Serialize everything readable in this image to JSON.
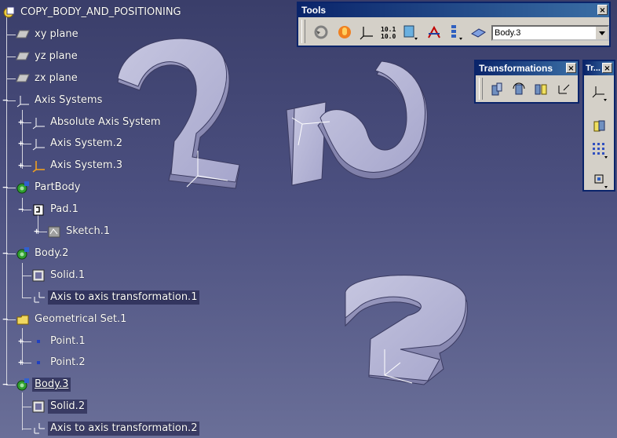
{
  "tree": {
    "nodes": [
      {
        "label": "COPY_BODY_AND_POSITIONING",
        "icon": "part-root-icon"
      },
      {
        "label": "xy plane",
        "icon": "plane-icon"
      },
      {
        "label": "yz plane",
        "icon": "plane-icon"
      },
      {
        "label": "zx plane",
        "icon": "plane-icon"
      },
      {
        "label": "Axis Systems",
        "icon": "axis-systems-icon"
      },
      {
        "label": "Absolute Axis System",
        "icon": "axis-system-icon"
      },
      {
        "label": "Axis System.2",
        "icon": "axis-system-icon"
      },
      {
        "label": "Axis System.3",
        "icon": "axis-system-active-icon"
      },
      {
        "label": "PartBody",
        "icon": "body-gear-icon"
      },
      {
        "label": "Pad.1",
        "icon": "pad-icon"
      },
      {
        "label": "Sketch.1",
        "icon": "sketch-icon"
      },
      {
        "label": "Body.2",
        "icon": "body-gear-icon"
      },
      {
        "label": "Solid.1",
        "icon": "solid-icon"
      },
      {
        "label": "Axis to axis transformation.1",
        "icon": "axis-transform-icon"
      },
      {
        "label": "Geometrical Set.1",
        "icon": "geometrical-set-icon"
      },
      {
        "label": "Point.1",
        "icon": "point-icon"
      },
      {
        "label": "Point.2",
        "icon": "point-icon"
      },
      {
        "label": "Body.3",
        "icon": "body-gear-icon"
      },
      {
        "label": "Solid.2",
        "icon": "solid-icon"
      },
      {
        "label": "Axis to axis transformation.2",
        "icon": "axis-transform-icon"
      }
    ]
  },
  "tools_toolbar": {
    "title": "Tools",
    "close": "×",
    "current_body": "Body.3",
    "buttons": [
      "update-icon",
      "hand-icon",
      "axis-system-icon",
      "unit-icon",
      "cube-dropdown-icon",
      "sketch-cut-icon",
      "list-dropdown-icon",
      "layer-icon"
    ]
  },
  "transformations_toolbar": {
    "title": "Transformations",
    "close": "×",
    "buttons": [
      "translate-icon",
      "rotate-icon",
      "symmetry-icon",
      "axis-to-axis-icon"
    ]
  },
  "tr_toolbar": {
    "title": "Tr...",
    "close": "×",
    "buttons": [
      "axis-dropdown-icon",
      "body-insert-icon",
      "pattern-dropdown-icon",
      "scale-dropdown-icon"
    ]
  },
  "colors": {
    "selection": "#1b1b47",
    "toolbar_title": "#0a246a",
    "part_face": "#b7b7d8",
    "part_side": "#8d8db4"
  }
}
